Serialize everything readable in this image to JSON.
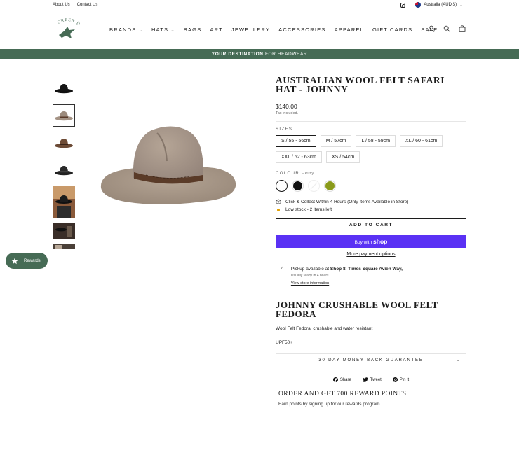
{
  "utility": {
    "links": [
      "About Us",
      "Contact Us"
    ],
    "locale": "Australia (AUD $)",
    "instagram_icon": "instagram-icon",
    "flag_icon": "au-flag-icon"
  },
  "header": {
    "logo_text": "GREEN DUCK",
    "nav": [
      "BRANDS",
      "HATS",
      "BAGS",
      "ART",
      "JEWELLERY",
      "ACCESSORIES",
      "APPAREL",
      "GIFT CARDS",
      "SALE"
    ],
    "nav_dropdown_indices": [
      0,
      1
    ],
    "icons": [
      "user-icon",
      "search-icon",
      "cart-icon"
    ]
  },
  "banner": {
    "bold": "YOUR DESTINATION",
    "rest": "FOR HEADWEAR",
    "color": "#466b55"
  },
  "thumbnails": {
    "count": 7,
    "active_index": 1
  },
  "rewards": {
    "label": "Rewards",
    "icon": "star-icon"
  },
  "product": {
    "title": "AUSTRALIAN WOOL FELT SAFARI HAT - JOHNNY",
    "price": "$140.00",
    "tax": "Tax included.",
    "sizes_label": "SIZES",
    "sizes": [
      "S / 55 - 56cm",
      "M / 57cm",
      "L / 58 - 59cm",
      "XL / 60 - 61cm",
      "XXL / 62 - 63cm",
      "XS / 54cm"
    ],
    "selected_size_index": 0,
    "colour_label": "COLOUR",
    "colour_selected": "– Putty",
    "colours": [
      {
        "name": "Putty",
        "hex": "#ffffff"
      },
      {
        "name": "Black",
        "hex": "#111111"
      },
      {
        "name": "White",
        "hex": "#ffffff"
      },
      {
        "name": "Olive",
        "hex": "#8a9a1a"
      }
    ],
    "click_collect": "Click & Collect Within 4 Hours (Only Items Available in Store)",
    "stock": "Low stock - 2 items left",
    "add_to_cart": "ADD TO CART",
    "buy_with": "Buy with",
    "shop_brand": "shop",
    "more_payment": "More payment options",
    "pickup_prefix": "Pickup available at",
    "pickup_location": "Shop 8, Times Square Avien Way,",
    "pickup_ready": "Usually ready in 4 hours",
    "store_info": "View store information"
  },
  "details": {
    "subtitle": "JOHNNY CRUSHABLE WOOL FELT FEDORA",
    "desc": "Wool Felt Fedora, crushable and water resistant",
    "upf": "UPF50+",
    "guarantee": "30 DAY MONEY BACK GUARANTEE",
    "share": "Share",
    "tweet": "Tweet",
    "pin": "Pin it",
    "order_title": "ORDER AND GET 700 REWARD POINTS",
    "order_desc": "Earn points by signing up for our rewards program"
  }
}
